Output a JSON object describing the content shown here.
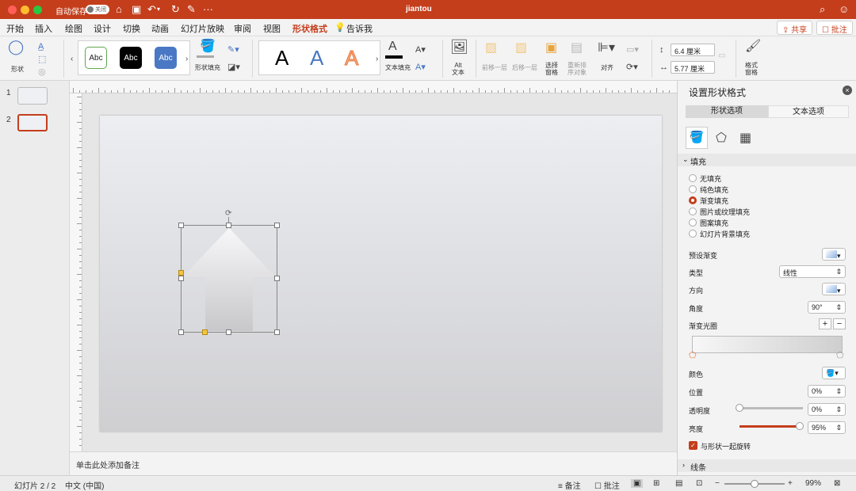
{
  "titlebar": {
    "autosave_label": "自动保存",
    "autosave_state": "关闭",
    "doc_title": "jiantou",
    "colors": {
      "bar": "#c43e1c"
    }
  },
  "tabs": [
    "开始",
    "插入",
    "绘图",
    "设计",
    "切换",
    "动画",
    "幻灯片放映",
    "审阅",
    "视图",
    "形状格式"
  ],
  "tell_me": "告诉我",
  "share_label": "共享",
  "comment_label": "批注",
  "ribbon": {
    "shape_label": "形状",
    "style_samples": [
      "Abc",
      "Abc",
      "Abc"
    ],
    "shape_fill_label": "形状填充",
    "wordart_samples": [
      "A",
      "A",
      "A"
    ],
    "text_fill_label": "文本填充",
    "alt_text_label": "Alt\n文本",
    "bring_forward": "前移一层",
    "send_backward": "后移一层",
    "selection_pane": "选择\n窗格",
    "reorder": "重新排\n序对象",
    "align": "对齐",
    "height": "6.4 厘米",
    "width": "5.77 厘米",
    "format_pane": "格式\n窗格"
  },
  "slides": [
    "1",
    "2"
  ],
  "notes_placeholder": "单击此处添加备注",
  "panel": {
    "title": "设置形状格式",
    "tabs": [
      "形状选项",
      "文本选项"
    ],
    "section_fill": "填充",
    "fill_options": [
      "无填充",
      "纯色填充",
      "渐变填充",
      "图片或纹理填充",
      "图案填充",
      "幻灯片背景填充"
    ],
    "selected_fill": "渐变填充",
    "preset_gradient": "预设渐变",
    "type_label": "类型",
    "type_value": "线性",
    "direction_label": "方向",
    "angle_label": "角度",
    "angle_value": "90°",
    "stops_label": "渐变光圈",
    "color_label": "颜色",
    "position_label": "位置",
    "position_value": "0%",
    "transparency_label": "透明度",
    "transparency_value": "0%",
    "transparency_level": 0,
    "brightness_label": "亮度",
    "brightness_value": "95%",
    "brightness_level": 0.95,
    "rotate_with_shape": "与形状一起旋转",
    "section_line": "线条"
  },
  "status": {
    "slide_info": "幻灯片 2 / 2",
    "language": "中文 (中国)",
    "notes": "备注",
    "comments": "批注",
    "zoom": "99%",
    "zoom_level": 0.5
  }
}
